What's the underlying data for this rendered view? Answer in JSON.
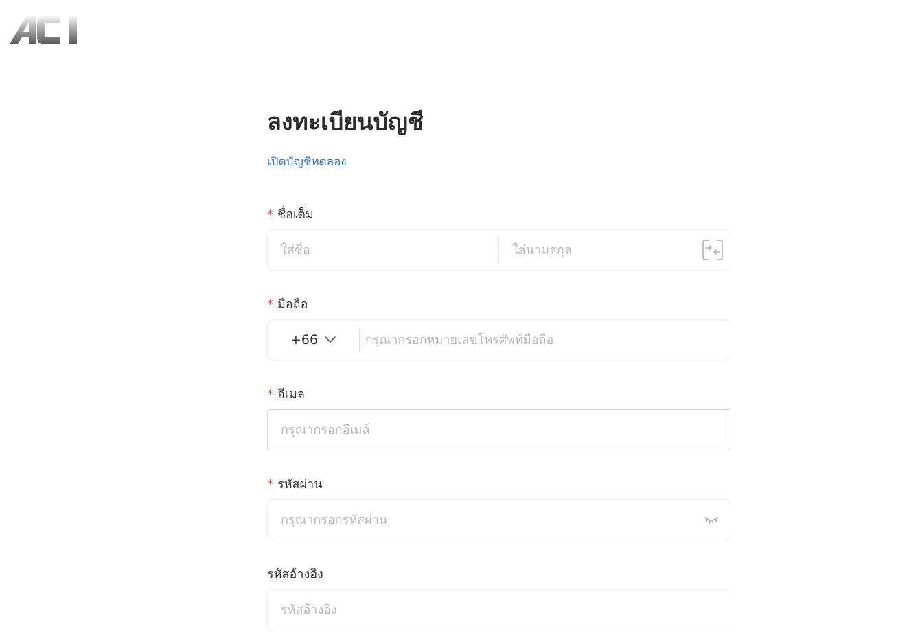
{
  "brand": {
    "logo_text": "ACI"
  },
  "form": {
    "title": "ลงทะเบียนบัญชี",
    "trial_link": "เปิดบัญชีทดลอง",
    "required_mark": "*",
    "full_name": {
      "label": "ชื่อเต็ม",
      "first_placeholder": "ใส่ชื่อ",
      "last_placeholder": "ใส่นามสกุล",
      "swap_icon": "swap-fields-icon"
    },
    "mobile": {
      "label": "มือถือ",
      "country_code": "+66",
      "placeholder": "กรุณากรอกหมายเลขโทรศัพท์มือถือ"
    },
    "email": {
      "label": "อีเมล",
      "placeholder": "กรุณากรอกอีเมล์"
    },
    "password": {
      "label": "รหัสผ่าน",
      "placeholder": "กรุณากรอกรหัสผ่าน",
      "toggle_icon": "eye-closed-icon"
    },
    "referral": {
      "label": "รหัสอ้างอิง",
      "placeholder": "รหัสอ้างอิง"
    }
  },
  "colors": {
    "required": "#e04f4f",
    "link": "#2f6fd1",
    "placeholder": "#b8b8b8",
    "border": "#ececec"
  }
}
